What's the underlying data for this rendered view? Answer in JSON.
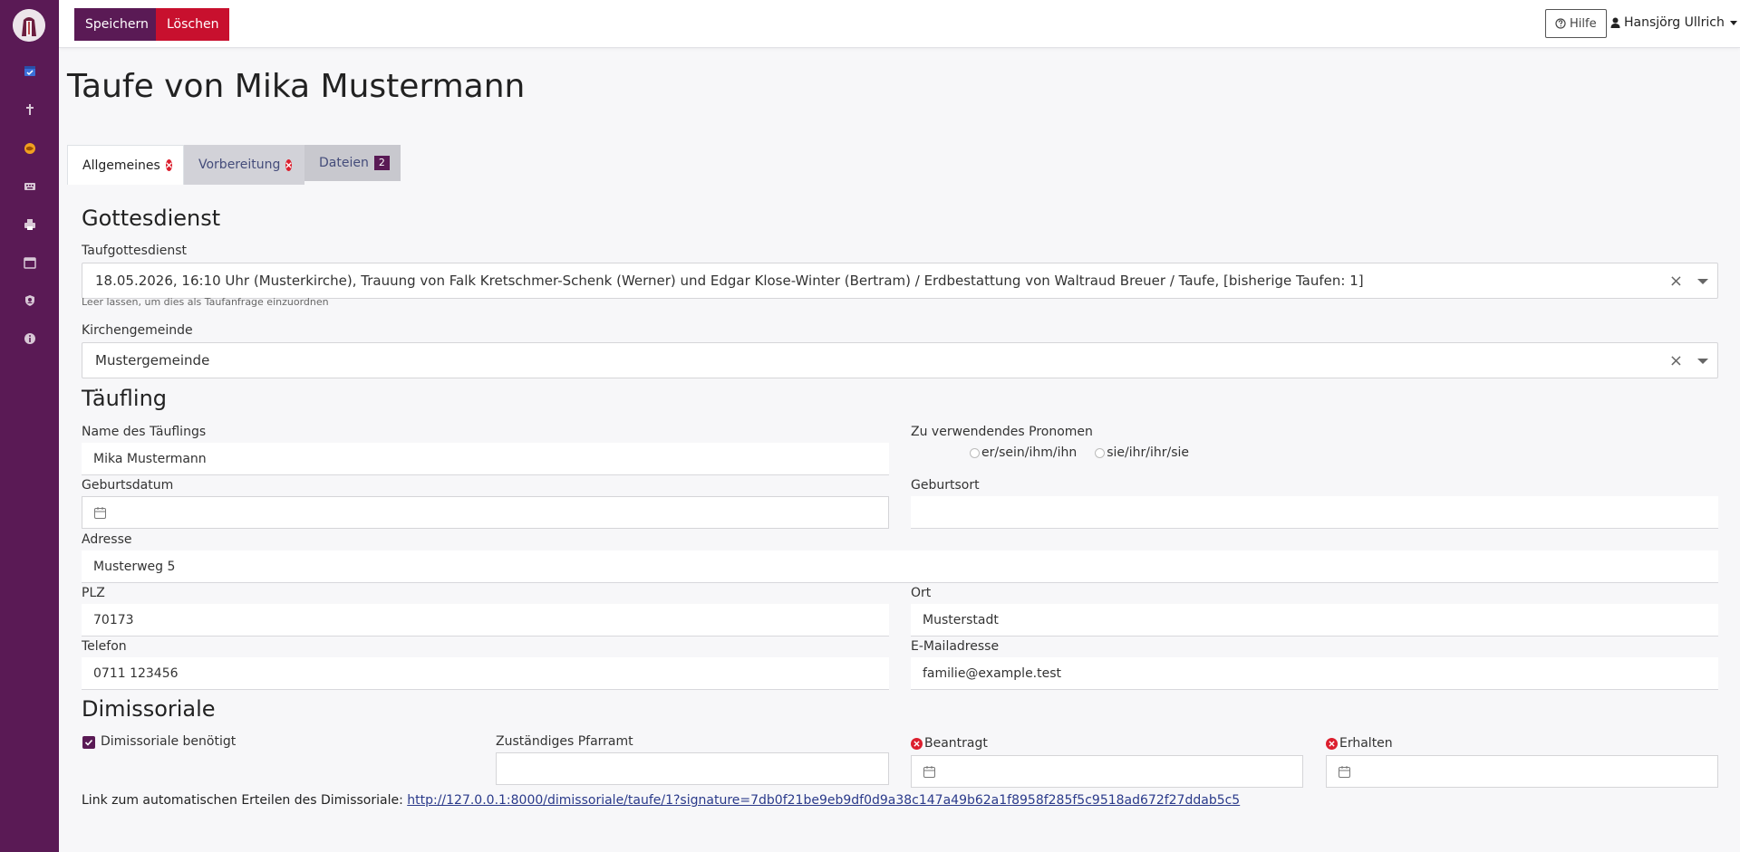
{
  "toolbar": {
    "save_label": "Speichern",
    "delete_label": "Löschen",
    "help_label": "Hilfe",
    "user_name": "Hansjörg Ullrich"
  },
  "sidebar": {
    "items": [
      {
        "icon": "calendar-check-icon"
      },
      {
        "icon": "cross-icon"
      },
      {
        "icon": "globe-icon"
      },
      {
        "icon": "keyboard-icon"
      },
      {
        "icon": "printer-icon"
      },
      {
        "icon": "calendar-icon"
      },
      {
        "icon": "user-shield-icon"
      },
      {
        "icon": "info-icon"
      }
    ]
  },
  "page": {
    "title": "Taufe von Mika Mustermann"
  },
  "tabs": {
    "general": "Allgemeines",
    "preparation": "Vorbereitung",
    "files": "Dateien",
    "files_count": "2"
  },
  "sections": {
    "service": "Gottesdienst",
    "child": "Täufling",
    "dimissoriale": "Dimissoriale"
  },
  "service": {
    "service_label": "Taufgottesdienst",
    "service_value": "18.05.2026, 16:10 Uhr (Musterkirche), Trauung von Falk Kretschmer-Schenk (Werner) und Edgar Klose-Winter (Bertram) / Erdbestattung von Waltraud Breuer / Taufe, [bisherige Taufen: 1]",
    "service_hint": "Leer lassen, um dies als Taufanfrage einzuordnen",
    "parish_label": "Kirchengemeinde",
    "parish_value": "Mustergemeinde"
  },
  "child": {
    "name_label": "Name des Täuflings",
    "name_value": "Mika Mustermann",
    "pronoun_label": "Zu verwendendes Pronomen",
    "pronoun_option_1": "er/sein/ihm/ihn",
    "pronoun_option_2": "sie/ihr/ihr/sie",
    "birthdate_label": "Geburtsdatum",
    "birthdate_value": "",
    "birthplace_label": "Geburtsort",
    "birthplace_value": "",
    "address_label": "Adresse",
    "address_value": "Musterweg 5",
    "zip_label": "PLZ",
    "zip_value": "70173",
    "city_label": "Ort",
    "city_value": "Musterstadt",
    "phone_label": "Telefon",
    "phone_value": "0711 123456",
    "email_label": "E-Mailadresse",
    "email_value": "familie@example.test"
  },
  "dimissoriale": {
    "needed_label": "Dimissoriale benötigt",
    "needed_checked": true,
    "office_label": "Zuständiges Pfarramt",
    "office_value": "",
    "requested_label": "Beantragt",
    "requested_value": "",
    "received_label": "Erhalten",
    "received_value": "",
    "link_prefix": "Link zum automatischen Erteilen des Dimissoriale:",
    "link_url": "http://127.0.0.1:8000/dimissoriale/taufe/1?signature=7db0f21be9eb9df0d9a38c147a49b62a1f8958f285f5c9518ad672f27ddab5c5"
  },
  "colors": {
    "brand": "#5a1a55",
    "danger": "#c8102e",
    "error_icon": "#dc1f2e",
    "link": "#2a3a8a"
  }
}
